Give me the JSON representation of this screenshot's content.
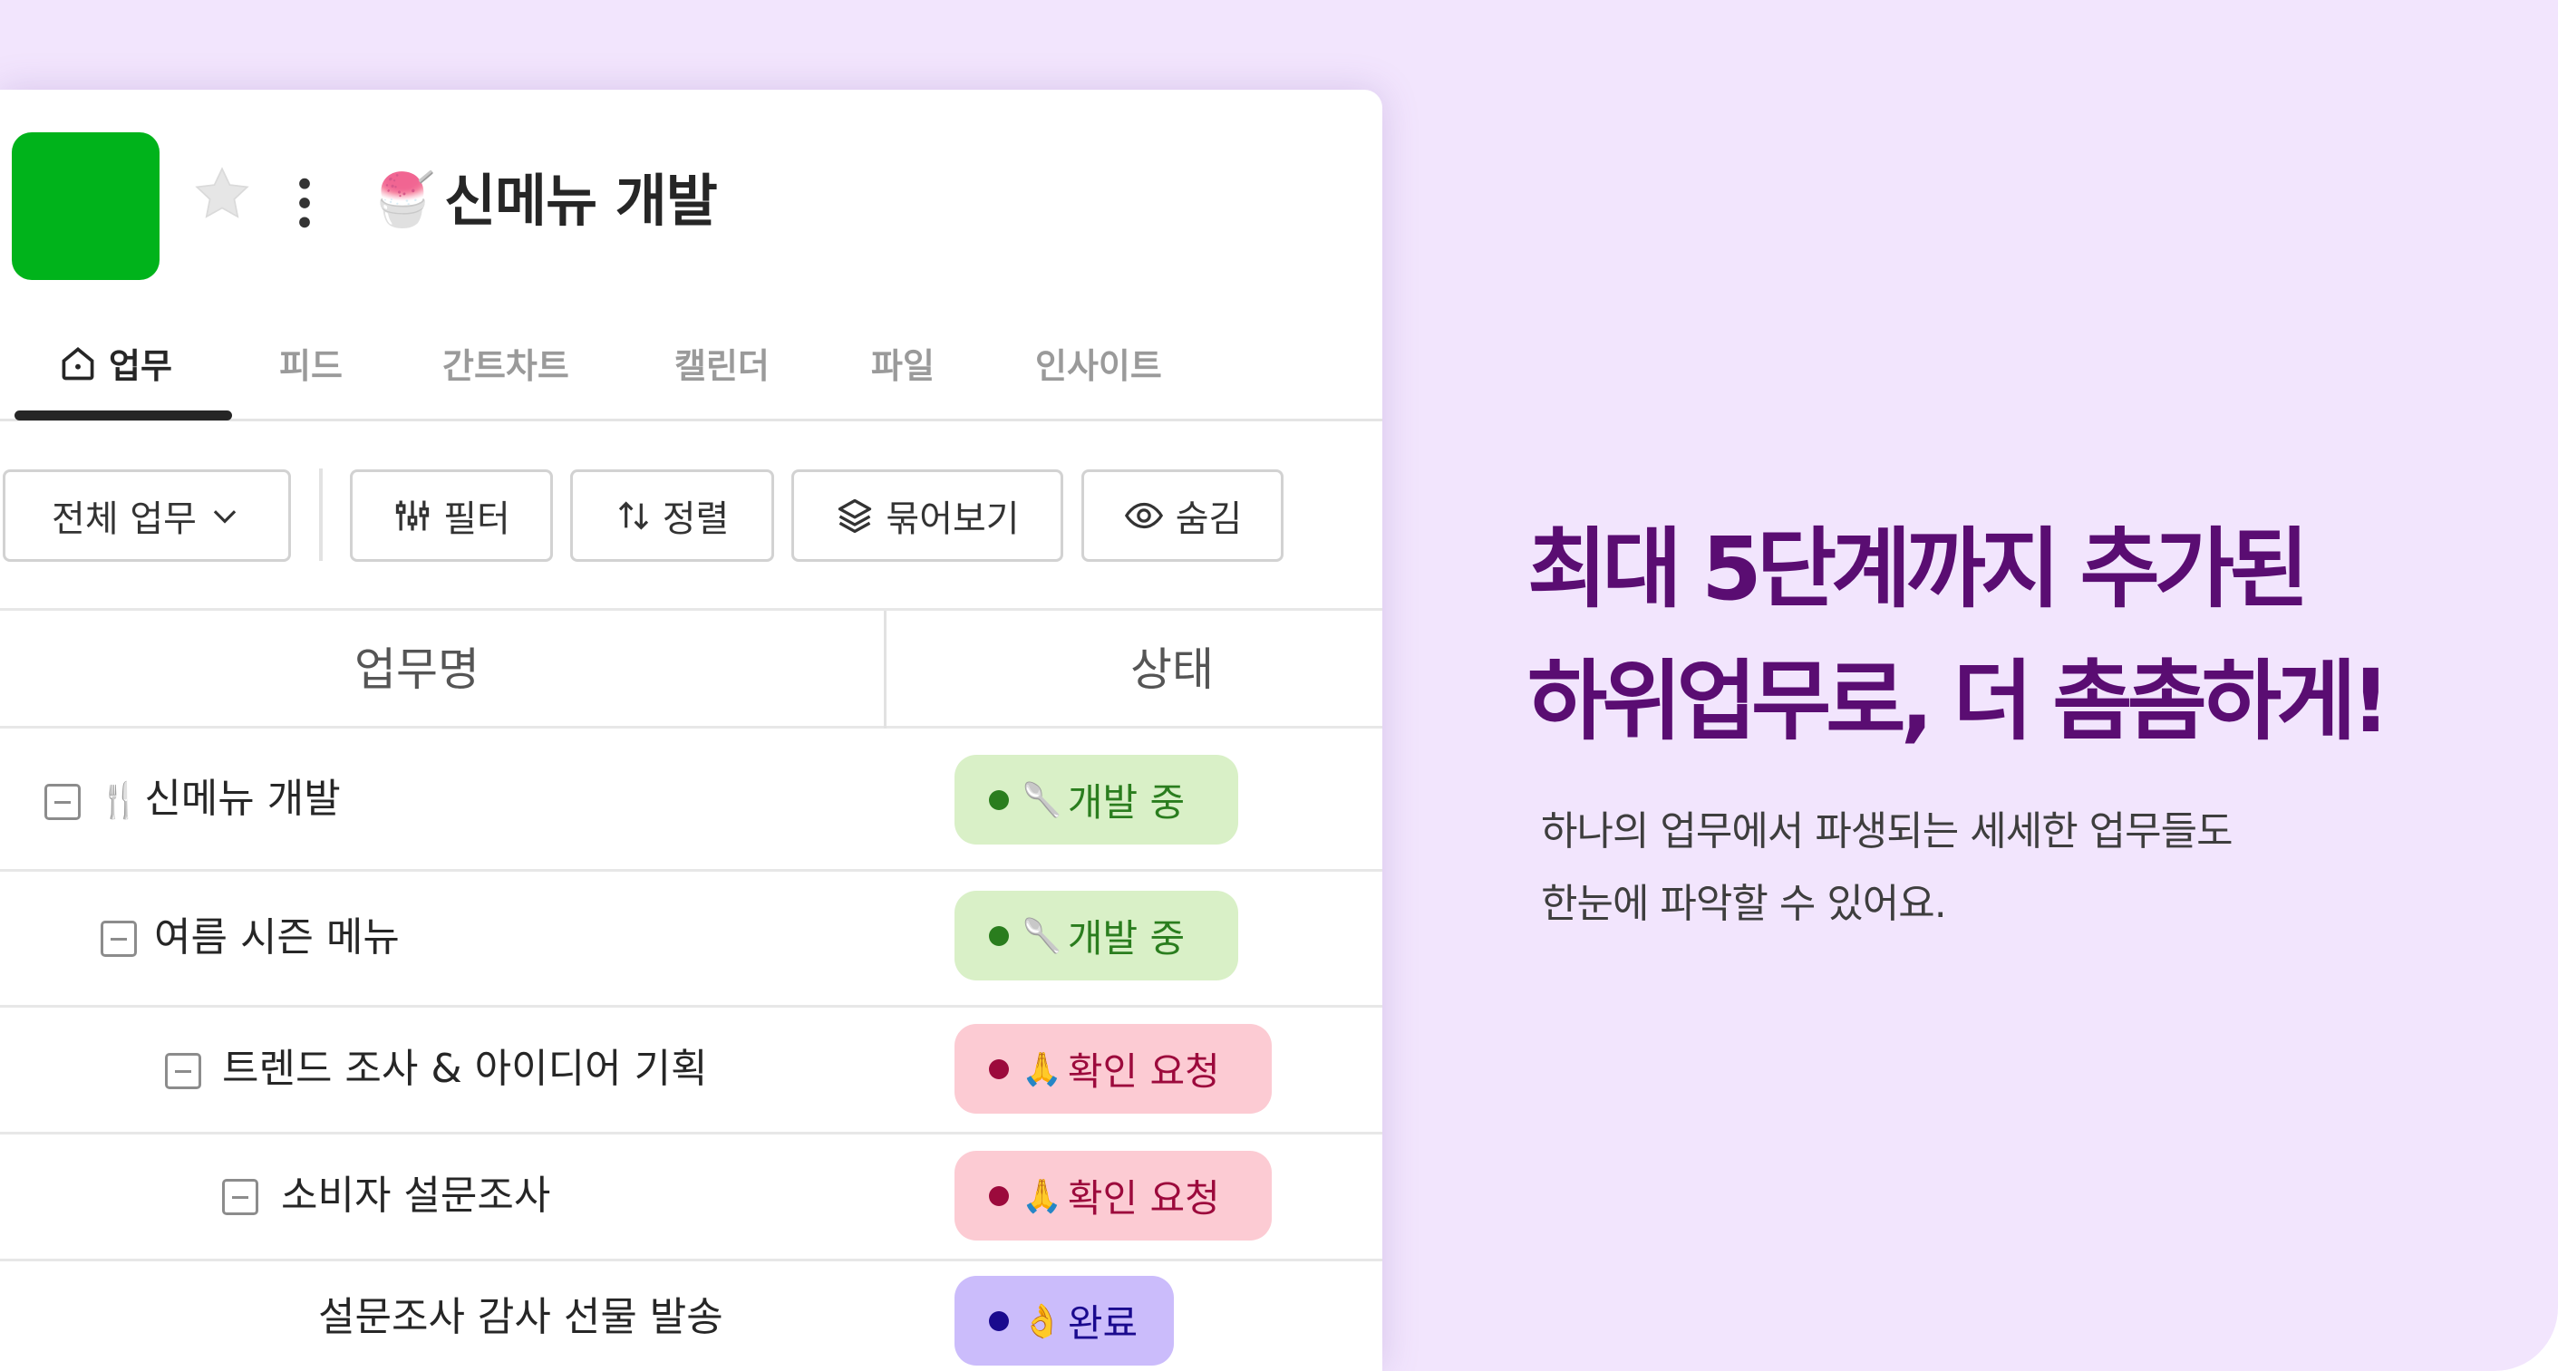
{
  "project": {
    "title": "신메뉴 개발",
    "title_emoji": "🍧",
    "color": "#00b31b"
  },
  "tabs": [
    {
      "label": "업무",
      "icon": "home-icon",
      "active": true
    },
    {
      "label": "피드"
    },
    {
      "label": "간트차트"
    },
    {
      "label": "캘린더"
    },
    {
      "label": "파일"
    },
    {
      "label": "인사이트"
    }
  ],
  "toolbar": {
    "view_select": "전체 업무",
    "filter": "필터",
    "sort": "정렬",
    "group": "묶어보기",
    "hide": "숨김"
  },
  "table": {
    "columns": [
      "업무명",
      "상태"
    ],
    "rows": [
      {
        "emoji": "🍴",
        "name": "신메뉴 개발",
        "status": "개발 중",
        "status_emoji": "🥄",
        "level": 0,
        "collapsible": true
      },
      {
        "emoji": "",
        "name": "여름 시즌 메뉴",
        "status": "개발 중",
        "status_emoji": "🥄",
        "level": 1,
        "collapsible": true
      },
      {
        "emoji": "",
        "name": "트렌드 조사 & 아이디어 기획",
        "status": "확인 요청",
        "status_emoji": "🙏",
        "level": 2,
        "collapsible": true
      },
      {
        "emoji": "",
        "name": "소비자 설문조사",
        "status": "확인 요청",
        "status_emoji": "🙏",
        "level": 3,
        "collapsible": true
      },
      {
        "emoji": "",
        "name": "설문조사 감사 선물 발송",
        "status": "완료",
        "status_emoji": "👌",
        "level": 4,
        "collapsible": false
      }
    ]
  },
  "status_colors": {
    "개발 중": {
      "bg": "#d9f0c7",
      "dot": "#2a7d1e",
      "text": "#2a7d1e"
    },
    "확인 요청": {
      "bg": "#fccbd3",
      "dot": "#9c0a3c",
      "text": "#9c0a3c"
    },
    "완료": {
      "bg": "#cbbcfb",
      "dot": "#1a0a8e",
      "text": "#1a0a8e"
    }
  },
  "marketing": {
    "headline_line1": "최대 5단계까지 추가된",
    "headline_line2": "하위업무로, 더 촘촘하게!",
    "sub_line1": "하나의 업무에서 파생되는 세세한 업무들도",
    "sub_line2": "한눈에 파악할 수 있어요."
  },
  "colors": {
    "background": "#f2e5fd",
    "headline": "#5a0d72"
  }
}
